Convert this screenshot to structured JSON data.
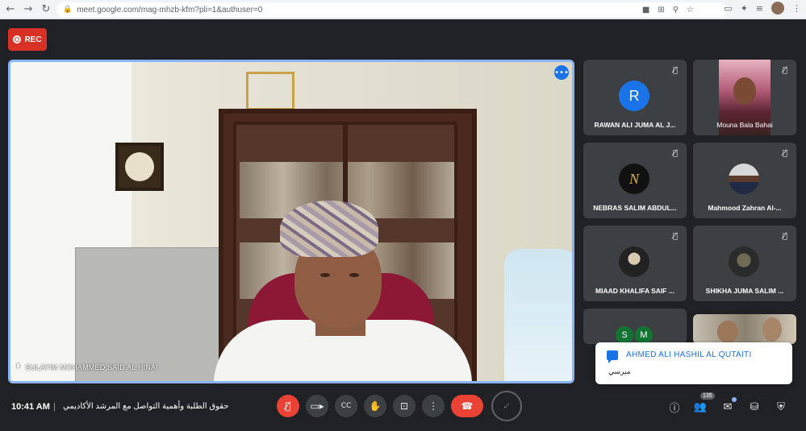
{
  "browser": {
    "url": "meet.google.com/mag-mhzb-kfm?pli=1&authuser=0",
    "back_icon": "←",
    "forward_icon": "→",
    "reload_icon": "↻"
  },
  "recording": {
    "label": "REC",
    "color": "#d93025"
  },
  "main_speaker": {
    "name": "SULAYIM MOHAMMED SAID AL HINAI",
    "more_icon": "•••"
  },
  "participants": [
    {
      "name": "RAWAN ALI JUMA AL J...",
      "initial": "R",
      "avatar_color": "#1a73e8",
      "muted": true
    },
    {
      "name": "Mouna Bala Bahai",
      "initial": "",
      "avatar_color": "",
      "muted": true
    },
    {
      "name": "NEBRAS SALIM ABDUL...",
      "initial": "N",
      "avatar_color": "#111111",
      "muted": true
    },
    {
      "name": "Mahmood Zahran Al-...",
      "initial": "",
      "avatar_color": "#6b6b6b",
      "muted": true
    },
    {
      "name": "MIAAD KHALIFA SAIF ...",
      "initial": "",
      "avatar_color": "#222222",
      "muted": true
    },
    {
      "name": "SHIKHA JUMA SALIM ...",
      "initial": "",
      "avatar_color": "#2b2b2b",
      "muted": true
    },
    {
      "name": "",
      "initial": "S",
      "initial2": "M",
      "avatar_color": "#137333",
      "muted": false
    },
    {
      "name": "",
      "initial": "",
      "avatar_color": "",
      "muted": false
    }
  ],
  "toast": {
    "sender": "AHMED ALI HASHIL AL QUTAITI",
    "message": "ﻣﯿﺮﺳﻲ"
  },
  "bottom_bar": {
    "time": "10:41 AM",
    "separator": "|",
    "meeting_name": "حقوق الطلبة وأهمية التواصل مع المرشد الأكاديمي",
    "participant_count": "135"
  },
  "colors": {
    "background": "#202124",
    "tile": "#3c4043",
    "accent": "#8ab4f8",
    "end_call": "#ea4335"
  }
}
